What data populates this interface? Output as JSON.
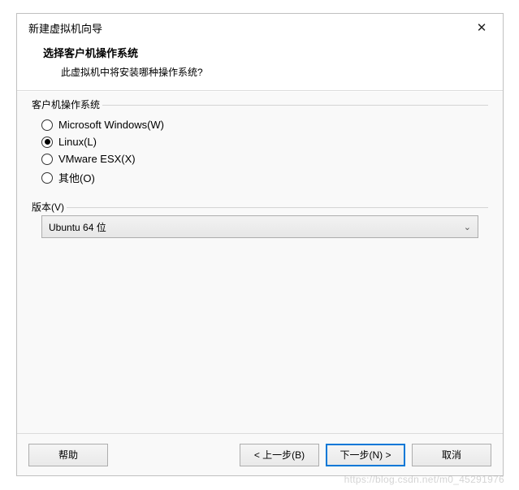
{
  "titlebar": {
    "title": "新建虚拟机向导",
    "close_icon": "✕"
  },
  "header": {
    "heading": "选择客户机操作系统",
    "subheading": "此虚拟机中将安装哪种操作系统?"
  },
  "os_group": {
    "legend": "客户机操作系统",
    "options": [
      {
        "label": "Microsoft Windows(W)",
        "checked": false
      },
      {
        "label": "Linux(L)",
        "checked": true
      },
      {
        "label": "VMware ESX(X)",
        "checked": false
      },
      {
        "label": "其他(O)",
        "checked": false
      }
    ]
  },
  "version": {
    "label": "版本(V)",
    "selected": "Ubuntu 64 位"
  },
  "footer": {
    "help": "帮助",
    "back": "< 上一步(B)",
    "next": "下一步(N) >",
    "cancel": "取消"
  },
  "watermark": "https://blog.csdn.net/m0_45291976"
}
